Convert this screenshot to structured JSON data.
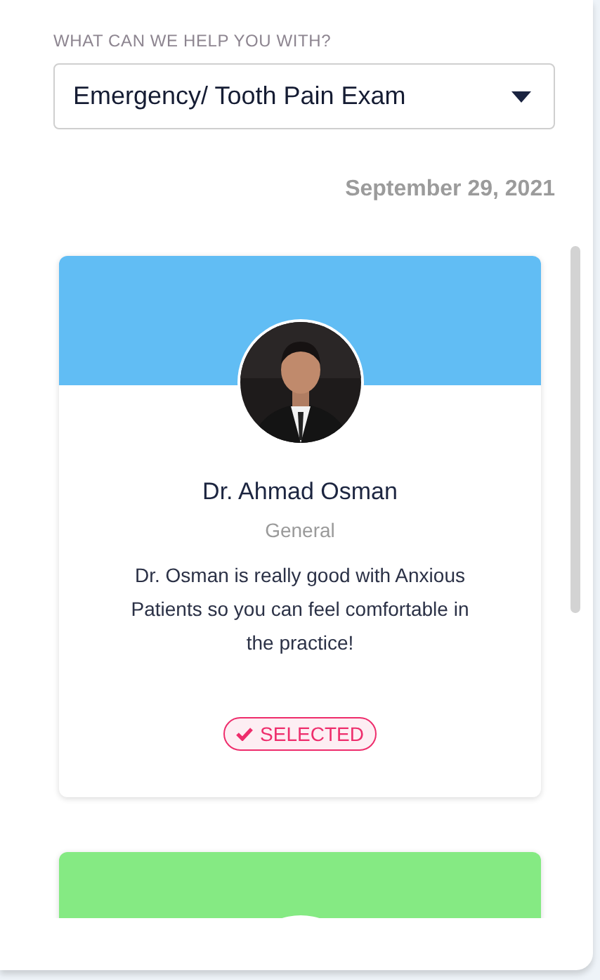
{
  "service_label": "WHAT CAN WE HELP YOU WITH?",
  "service_select": {
    "value": "Emergency/ Tooth Pain Exam"
  },
  "date": "September 29, 2021",
  "doctors": [
    {
      "color": "#61bdf4",
      "name": "Dr. Ahmad Osman",
      "specialty": "General",
      "description": "Dr. Osman is really good with Anxious Patients so you can feel comfortable in the practice!",
      "selected": true,
      "status": "SELECTED"
    },
    {
      "color": "#85ea83"
    }
  ]
}
